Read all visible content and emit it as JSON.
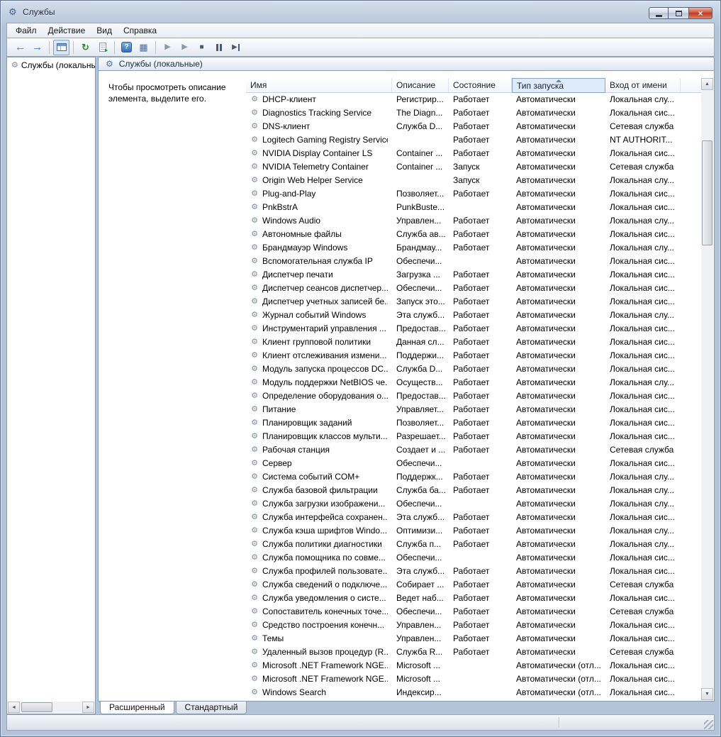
{
  "window": {
    "title": "Службы"
  },
  "colors": {
    "sorted_header_bg": "#ddebfb",
    "sorted_header_border": "#86a7cc",
    "close_button_bg": "#d0513a"
  },
  "icons": {
    "app": "⚙",
    "close": "×",
    "back": "←",
    "forward": "→",
    "refresh": "↻",
    "help": "?",
    "view_menu": "▦",
    "start": "▶",
    "resume": "▶",
    "stop": "■",
    "restart": "▶",
    "service": "⚙",
    "scroll_up": "▲",
    "scroll_down": "▼",
    "scroll_left": "◄",
    "scroll_right": "►"
  },
  "menubar": {
    "items": [
      "Файл",
      "Действие",
      "Вид",
      "Справка"
    ]
  },
  "tree": {
    "root": "Службы (локальные)"
  },
  "main": {
    "banner_title": "Службы (локальные)",
    "hint": "Чтобы просмотреть описание элемента, выделите его.",
    "columns": [
      "Имя",
      "Описание",
      "Состояние",
      "Тип запуска",
      "Вход от имени"
    ],
    "sorted_column": "Тип запуска",
    "tabs": [
      {
        "label": "Расширенный",
        "active": true
      },
      {
        "label": "Стандартный",
        "active": false
      }
    ],
    "rows": [
      {
        "name": "DHCP-клиент",
        "description": "Регистрир...",
        "status": "Работает",
        "startup": "Автоматически",
        "logon": "Локальная слу..."
      },
      {
        "name": "Diagnostics Tracking Service",
        "description": "The Diagn...",
        "status": "Работает",
        "startup": "Автоматически",
        "logon": "Локальная сис..."
      },
      {
        "name": "DNS-клиент",
        "description": "Служба D...",
        "status": "Работает",
        "startup": "Автоматически",
        "logon": "Сетевая служба"
      },
      {
        "name": "Logitech Gaming Registry Service",
        "description": "",
        "status": "Работает",
        "startup": "Автоматически",
        "logon": "NT AUTHORIT..."
      },
      {
        "name": "NVIDIA Display Container LS",
        "description": "Container ...",
        "status": "Работает",
        "startup": "Автоматически",
        "logon": "Локальная сис..."
      },
      {
        "name": "NVIDIA Telemetry Container",
        "description": "Container ...",
        "status": "Запуск",
        "startup": "Автоматически",
        "logon": "Сетевая служба"
      },
      {
        "name": "Origin Web Helper Service",
        "description": "",
        "status": "Запуск",
        "startup": "Автоматически",
        "logon": "Локальная слу..."
      },
      {
        "name": "Plug-and-Play",
        "description": "Позволяет...",
        "status": "Работает",
        "startup": "Автоматически",
        "logon": "Локальная сис..."
      },
      {
        "name": "PnkBstrA",
        "description": "PunkBuste...",
        "status": "",
        "startup": "Автоматически",
        "logon": "Локальная сис..."
      },
      {
        "name": "Windows Audio",
        "description": "Управлен...",
        "status": "Работает",
        "startup": "Автоматически",
        "logon": "Локальная слу..."
      },
      {
        "name": "Автономные файлы",
        "description": "Служба ав...",
        "status": "Работает",
        "startup": "Автоматически",
        "logon": "Локальная сис..."
      },
      {
        "name": "Брандмауэр Windows",
        "description": "Брандмау...",
        "status": "Работает",
        "startup": "Автоматически",
        "logon": "Локальная слу..."
      },
      {
        "name": "Вспомогательная служба IP",
        "description": "Обеспечи...",
        "status": "",
        "startup": "Автоматически",
        "logon": "Локальная сис..."
      },
      {
        "name": "Диспетчер печати",
        "description": "Загрузка ...",
        "status": "Работает",
        "startup": "Автоматически",
        "logon": "Локальная сис..."
      },
      {
        "name": "Диспетчер сеансов диспетчер...",
        "description": "Обеспечи...",
        "status": "Работает",
        "startup": "Автоматически",
        "logon": "Локальная сис..."
      },
      {
        "name": "Диспетчер учетных записей бе...",
        "description": "Запуск это...",
        "status": "Работает",
        "startup": "Автоматически",
        "logon": "Локальная сис..."
      },
      {
        "name": "Журнал событий Windows",
        "description": "Эта служб...",
        "status": "Работает",
        "startup": "Автоматически",
        "logon": "Локальная слу..."
      },
      {
        "name": "Инструментарий управления ...",
        "description": "Предостав...",
        "status": "Работает",
        "startup": "Автоматически",
        "logon": "Локальная сис..."
      },
      {
        "name": "Клиент групповой политики",
        "description": "Данная сл...",
        "status": "Работает",
        "startup": "Автоматически",
        "logon": "Локальная сис..."
      },
      {
        "name": "Клиент отслеживания измени...",
        "description": "Поддержи...",
        "status": "Работает",
        "startup": "Автоматически",
        "logon": "Локальная сис..."
      },
      {
        "name": "Модуль запуска процессов DC...",
        "description": "Служба D...",
        "status": "Работает",
        "startup": "Автоматически",
        "logon": "Локальная сис..."
      },
      {
        "name": "Модуль поддержки NetBIOS че...",
        "description": "Осуществ...",
        "status": "Работает",
        "startup": "Автоматически",
        "logon": "Локальная слу..."
      },
      {
        "name": "Определение оборудования о...",
        "description": "Предостав...",
        "status": "Работает",
        "startup": "Автоматически",
        "logon": "Локальная сис..."
      },
      {
        "name": "Питание",
        "description": "Управляет...",
        "status": "Работает",
        "startup": "Автоматически",
        "logon": "Локальная сис..."
      },
      {
        "name": "Планировщик заданий",
        "description": "Позволяет...",
        "status": "Работает",
        "startup": "Автоматически",
        "logon": "Локальная сис..."
      },
      {
        "name": "Планировщик классов мульти...",
        "description": "Разрешает...",
        "status": "Работает",
        "startup": "Автоматически",
        "logon": "Локальная сис..."
      },
      {
        "name": "Рабочая станция",
        "description": "Создает и ...",
        "status": "Работает",
        "startup": "Автоматически",
        "logon": "Сетевая служба"
      },
      {
        "name": "Сервер",
        "description": "Обеспечи...",
        "status": "",
        "startup": "Автоматически",
        "logon": "Локальная сис..."
      },
      {
        "name": "Система событий COM+",
        "description": "Поддержк...",
        "status": "Работает",
        "startup": "Автоматически",
        "logon": "Локальная слу..."
      },
      {
        "name": "Служба базовой фильтрации",
        "description": "Служба ба...",
        "status": "Работает",
        "startup": "Автоматически",
        "logon": "Локальная слу..."
      },
      {
        "name": "Служба загрузки изображени...",
        "description": "Обеспечи...",
        "status": "",
        "startup": "Автоматически",
        "logon": "Локальная слу..."
      },
      {
        "name": "Служба интерфейса сохранен...",
        "description": "Эта служб...",
        "status": "Работает",
        "startup": "Автоматически",
        "logon": "Локальная сис..."
      },
      {
        "name": "Служба кэша шрифтов Windo...",
        "description": "Оптимизи...",
        "status": "Работает",
        "startup": "Автоматически",
        "logon": "Локальная слу..."
      },
      {
        "name": "Служба политики диагностики",
        "description": "Служба п...",
        "status": "Работает",
        "startup": "Автоматически",
        "logon": "Локальная слу..."
      },
      {
        "name": "Служба помощника по совме...",
        "description": "Обеспечи...",
        "status": "",
        "startup": "Автоматически",
        "logon": "Локальная сис..."
      },
      {
        "name": "Служба профилей пользовате...",
        "description": "Эта служб...",
        "status": "Работает",
        "startup": "Автоматически",
        "logon": "Локальная сис..."
      },
      {
        "name": "Служба сведений о подключе...",
        "description": "Собирает ...",
        "status": "Работает",
        "startup": "Автоматически",
        "logon": "Сетевая служба"
      },
      {
        "name": "Служба уведомления о систе...",
        "description": "Ведет наб...",
        "status": "Работает",
        "startup": "Автоматически",
        "logon": "Локальная сис..."
      },
      {
        "name": "Сопоставитель конечных точе...",
        "description": "Обеспечи...",
        "status": "Работает",
        "startup": "Автоматически",
        "logon": "Сетевая служба"
      },
      {
        "name": "Средство построения конечн...",
        "description": "Управлен...",
        "status": "Работает",
        "startup": "Автоматически",
        "logon": "Локальная сис..."
      },
      {
        "name": "Темы",
        "description": "Управлен...",
        "status": "Работает",
        "startup": "Автоматически",
        "logon": "Локальная сис..."
      },
      {
        "name": "Удаленный вызов процедур (R...",
        "description": "Служба R...",
        "status": "Работает",
        "startup": "Автоматически",
        "logon": "Сетевая служба"
      },
      {
        "name": "Microsoft .NET Framework NGE...",
        "description": "Microsoft ...",
        "status": "",
        "startup": "Автоматически (отл...",
        "logon": "Локальная сис..."
      },
      {
        "name": "Microsoft .NET Framework NGE...",
        "description": "Microsoft ...",
        "status": "",
        "startup": "Автоматически (отл...",
        "logon": "Локальная сис..."
      },
      {
        "name": "Windows Search",
        "description": "Индексир...",
        "status": "",
        "startup": "Автоматически (отл...",
        "logon": "Локальная сис..."
      }
    ]
  }
}
